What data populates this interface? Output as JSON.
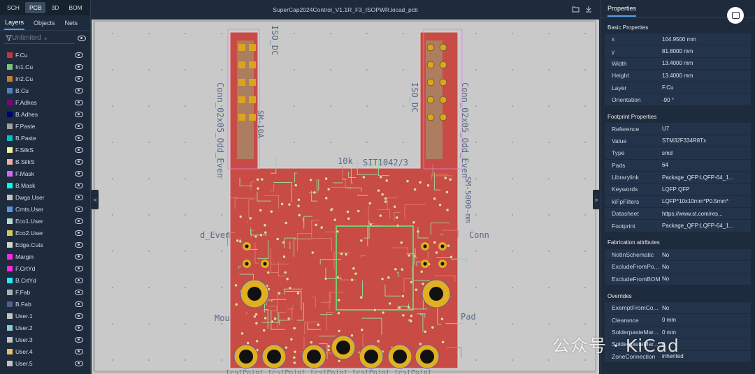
{
  "view_tabs": [
    "SCH",
    "PCB",
    "3D",
    "BOM"
  ],
  "active_view": "PCB",
  "panel_tabs": [
    "Layers",
    "Objects",
    "Nets"
  ],
  "filter": {
    "placeholder": "Unlimited"
  },
  "file_title": "SuperCap2024Control_V1.1R_F3_ISOPWR.kicad_pcb",
  "layers": [
    {
      "name": "F.Cu",
      "color": "#c83434"
    },
    {
      "name": "In1.Cu",
      "color": "#7fc27f"
    },
    {
      "name": "In2.Cu",
      "color": "#c27f34"
    },
    {
      "name": "B.Cu",
      "color": "#4d7fc4"
    },
    {
      "name": "F.Adhes",
      "color": "#84007f"
    },
    {
      "name": "B.Adhes",
      "color": "#00007f"
    },
    {
      "name": "F.Paste",
      "color": "#a79d9d"
    },
    {
      "name": "B.Paste",
      "color": "#00c2c2"
    },
    {
      "name": "F.SilkS",
      "color": "#f2eda1"
    },
    {
      "name": "B.SilkS",
      "color": "#e8b2a7"
    },
    {
      "name": "F.Mask",
      "color": "#d864ff"
    },
    {
      "name": "B.Mask",
      "color": "#02ffee"
    },
    {
      "name": "Dwgs.User",
      "color": "#c2c2c2"
    },
    {
      "name": "Cmts.User",
      "color": "#5994dc"
    },
    {
      "name": "Eco1.User",
      "color": "#b4dbd2"
    },
    {
      "name": "Eco2.User",
      "color": "#d8c852"
    },
    {
      "name": "Edge.Cuts",
      "color": "#d0d2cd"
    },
    {
      "name": "Margin",
      "color": "#ff26e2"
    },
    {
      "name": "F.CrtYd",
      "color": "#ff26e2"
    },
    {
      "name": "B.CrtYd",
      "color": "#26e9ff"
    },
    {
      "name": "F.Fab",
      "color": "#afafaf"
    },
    {
      "name": "B.Fab",
      "color": "#585d84"
    },
    {
      "name": "User.1",
      "color": "#c2c2c2"
    },
    {
      "name": "User.2",
      "color": "#89cbd9"
    },
    {
      "name": "User.3",
      "color": "#c2c2c2"
    },
    {
      "name": "User.4",
      "color": "#e8c060"
    },
    {
      "name": "User.5",
      "color": "#c2c2c2"
    }
  ],
  "properties": {
    "title": "Properties",
    "basic_title": "Basic Properties",
    "basic": [
      {
        "k": "x",
        "v": "104.9500 mm"
      },
      {
        "k": "y",
        "v": "81.8000 mm"
      },
      {
        "k": "Width",
        "v": "13.4000 mm"
      },
      {
        "k": "Height",
        "v": "13.4000 mm"
      },
      {
        "k": "Layer",
        "v": "F.Cu"
      },
      {
        "k": "Orientation",
        "v": "-90 °"
      }
    ],
    "footprint_title": "Footprint Properties",
    "footprint": [
      {
        "k": "Reference",
        "v": "U7"
      },
      {
        "k": "Value",
        "v": "STM32F334R8Tx"
      },
      {
        "k": "Type",
        "v": "smd"
      },
      {
        "k": "Pads",
        "v": "64"
      },
      {
        "k": "Librarylink",
        "v": "Package_QFP:LQFP-64_1..."
      },
      {
        "k": "Keywords",
        "v": "LQFP QFP"
      },
      {
        "k": "kiFpFilters",
        "v": "LQFP*10x10mm*P0.5mm*"
      },
      {
        "k": "Datasheet",
        "v": "https://www.st.com/res..."
      },
      {
        "k": "Footprint",
        "v": "Package_QFP:LQFP-64_1..."
      }
    ],
    "fab_title": "Fabrication attributes",
    "fab": [
      {
        "k": "NotInSchematic",
        "v": "No"
      },
      {
        "k": "ExcludeFromPo...",
        "v": "No"
      },
      {
        "k": "ExcludeFromBOM",
        "v": "No"
      }
    ],
    "over_title": "Overrides",
    "overrides": [
      {
        "k": "ExemptFromCo...",
        "v": "No"
      },
      {
        "k": "Clearance",
        "v": "0 mm"
      },
      {
        "k": "SolderpasteMar...",
        "v": "0 mm"
      },
      {
        "k": "SolderpasteMar...",
        "v": "0"
      },
      {
        "k": "ZoneConnection",
        "v": "inherited"
      }
    ]
  },
  "pcb_labels": {
    "iso_dc_left": "ISO_DC",
    "iso_dc_right": "ISO_DC",
    "conn_left": "Conn_02x05_Odd_Even",
    "conn_right": "Conn_02x05_Odd_Even",
    "sm_left": "SM-10A",
    "sm_right": "SM-5000-mm",
    "r10k": "10k",
    "sit": "SIT1042/3",
    "odd_even": "d_Even",
    "conn_mid": "Conn",
    "mou": "Mou",
    "pad": "Pad",
    "bottom_text": "testPoint testPoint testPoint testPoint testPoint"
  },
  "watermark": "公众号 · KiCad"
}
